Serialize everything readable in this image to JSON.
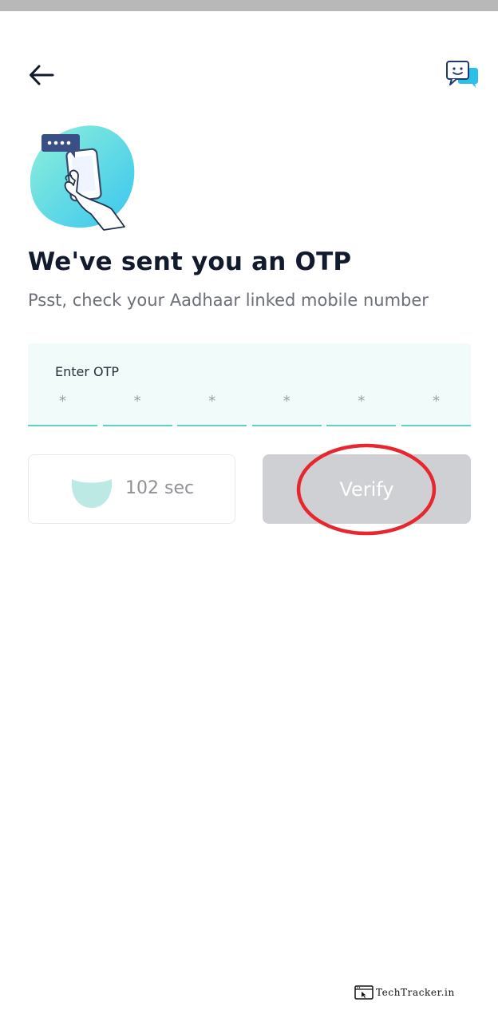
{
  "header": {
    "back_icon": "arrow-left-icon",
    "support_icon": "chat-support-icon"
  },
  "content": {
    "title": "We've sent you an OTP",
    "subtitle": "Psst, check your Aadhaar linked mobile number"
  },
  "otp": {
    "label": "Enter OTP",
    "digits": [
      "*",
      "*",
      "*",
      "*",
      "*",
      "*"
    ]
  },
  "actions": {
    "timer_text": "102 sec",
    "verify_label": "Verify"
  },
  "colors": {
    "accent": "#5ed1c3",
    "verify_disabled": "#cfd0d4",
    "annotation": "#e8262e"
  },
  "watermark": {
    "logo_text": "TechTracker.in"
  }
}
